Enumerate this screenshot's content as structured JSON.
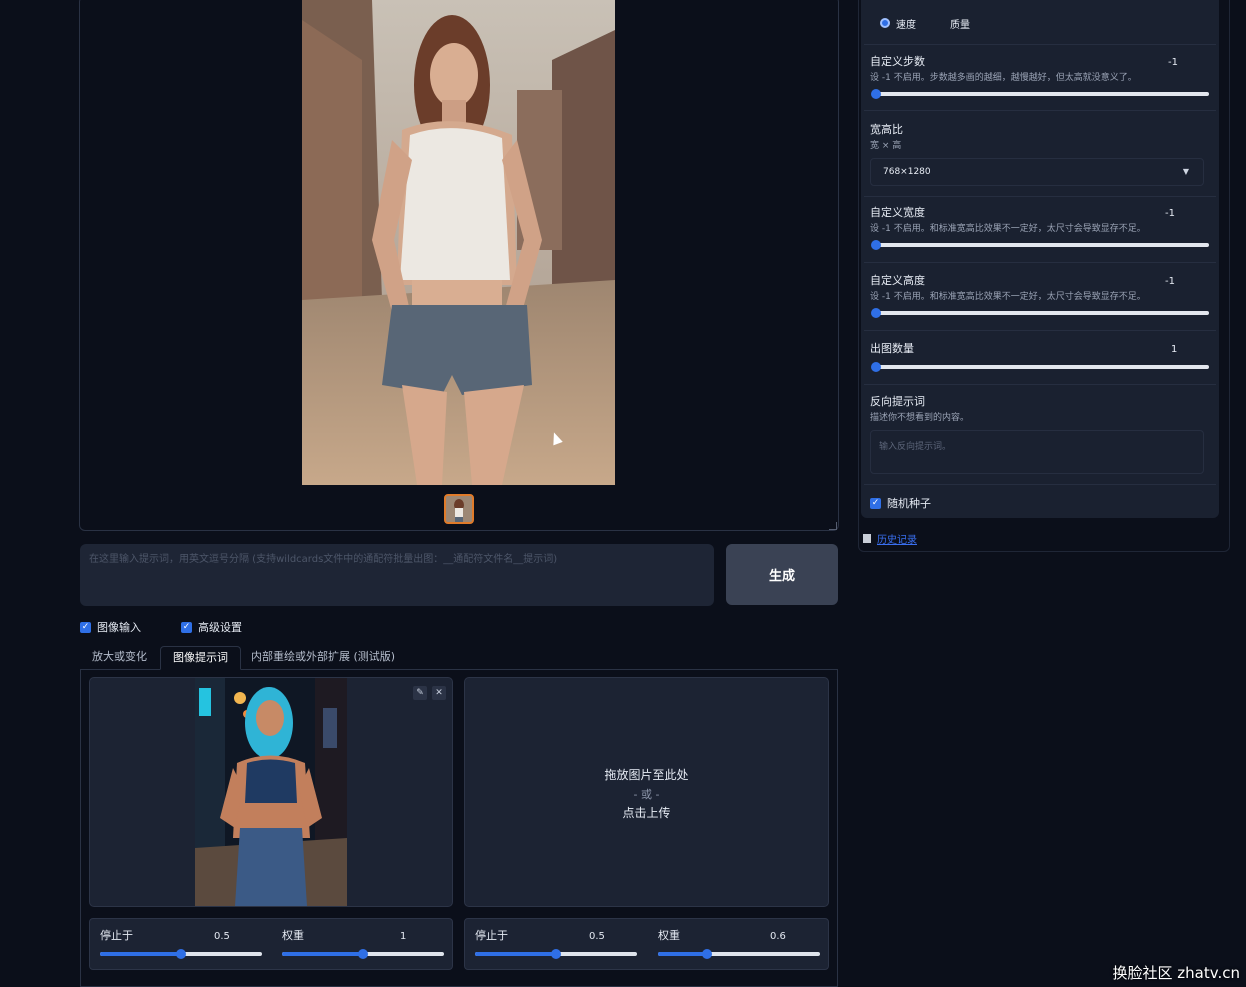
{
  "prompt": {
    "placeholder": "在这里输入提示词，用英文逗号分隔 (支持wildcards文件中的通配符批量出图：__通配符文件名__提示词)",
    "generate_label": "生成"
  },
  "checkboxes": {
    "image_input": "图像输入",
    "advanced": "高级设置"
  },
  "tabs": [
    "放大或变化",
    "图像提示词",
    "内部重绘或外部扩展 (测试版)"
  ],
  "upload": {
    "line1": "拖放图片至此处",
    "line2": "- 或 -",
    "line3": "点击上传"
  },
  "sliders": [
    {
      "label": "停止于",
      "value": "0.5",
      "fraction": 0.5
    },
    {
      "label": "权重",
      "value": "1",
      "fraction": 0.5
    },
    {
      "label": "停止于",
      "value": "0.5",
      "fraction": 0.5
    },
    {
      "label": "权重",
      "value": "0.6",
      "fraction": 0.3
    }
  ],
  "settings": {
    "performance": {
      "speed": "速度",
      "quality": "质量"
    },
    "steps": {
      "label": "自定义步数",
      "desc": "设 -1 不启用。步数越多画的越细，越慢越好，但太高就没意义了。",
      "value": "-1"
    },
    "aspect": {
      "label": "宽高比",
      "desc": "宽 × 高",
      "value": "768×1280"
    },
    "width": {
      "label": "自定义宽度",
      "desc": "设 -1 不启用。和标准宽高比效果不一定好，太尺寸会导致显存不足。",
      "value": "-1"
    },
    "height": {
      "label": "自定义高度",
      "desc": "设 -1 不启用。和标准宽高比效果不一定好，太尺寸会导致显存不足。",
      "value": "-1"
    },
    "count": {
      "label": "出图数量",
      "value": "1"
    },
    "negative": {
      "label": "反向提示词",
      "desc": "描述你不想看到的内容。",
      "placeholder": "输入反向提示词。"
    },
    "random_seed": "随机种子",
    "log_link": "历史记录"
  },
  "watermark": "换脸社区 zhatv.cn"
}
